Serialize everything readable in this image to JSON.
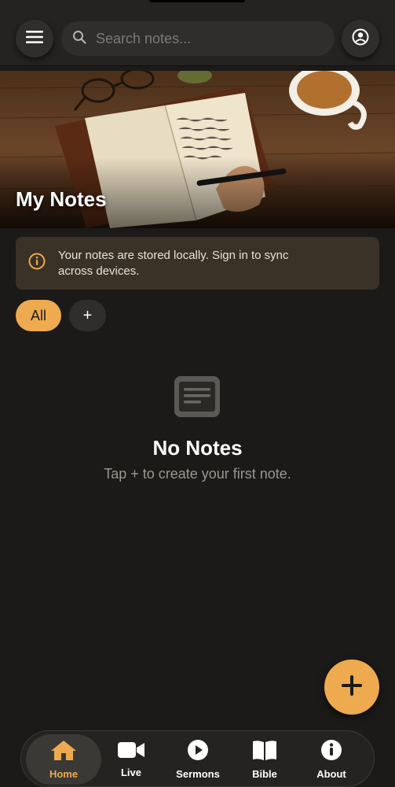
{
  "search": {
    "placeholder": "Search notes..."
  },
  "hero": {
    "title": "My Notes"
  },
  "notice": {
    "text": "Your notes are stored locally. Sign in to sync across devices."
  },
  "filters": {
    "all_label": "All",
    "add_label": "+"
  },
  "empty": {
    "title": "No Notes",
    "subtitle": "Tap + to create your first note."
  },
  "fab": {
    "label": "+"
  },
  "nav": {
    "items": [
      {
        "label": "Home",
        "icon": "home-icon",
        "active": true
      },
      {
        "label": "Live",
        "icon": "video-icon",
        "active": false
      },
      {
        "label": "Sermons",
        "icon": "play-icon",
        "active": false
      },
      {
        "label": "Bible",
        "icon": "book-icon",
        "active": false
      },
      {
        "label": "About",
        "icon": "info-icon",
        "active": false
      }
    ]
  },
  "colors": {
    "accent": "#eeaa4f",
    "background": "#1b1a19",
    "surface": "#2f2e2d",
    "notice_bg": "#3a3127"
  }
}
